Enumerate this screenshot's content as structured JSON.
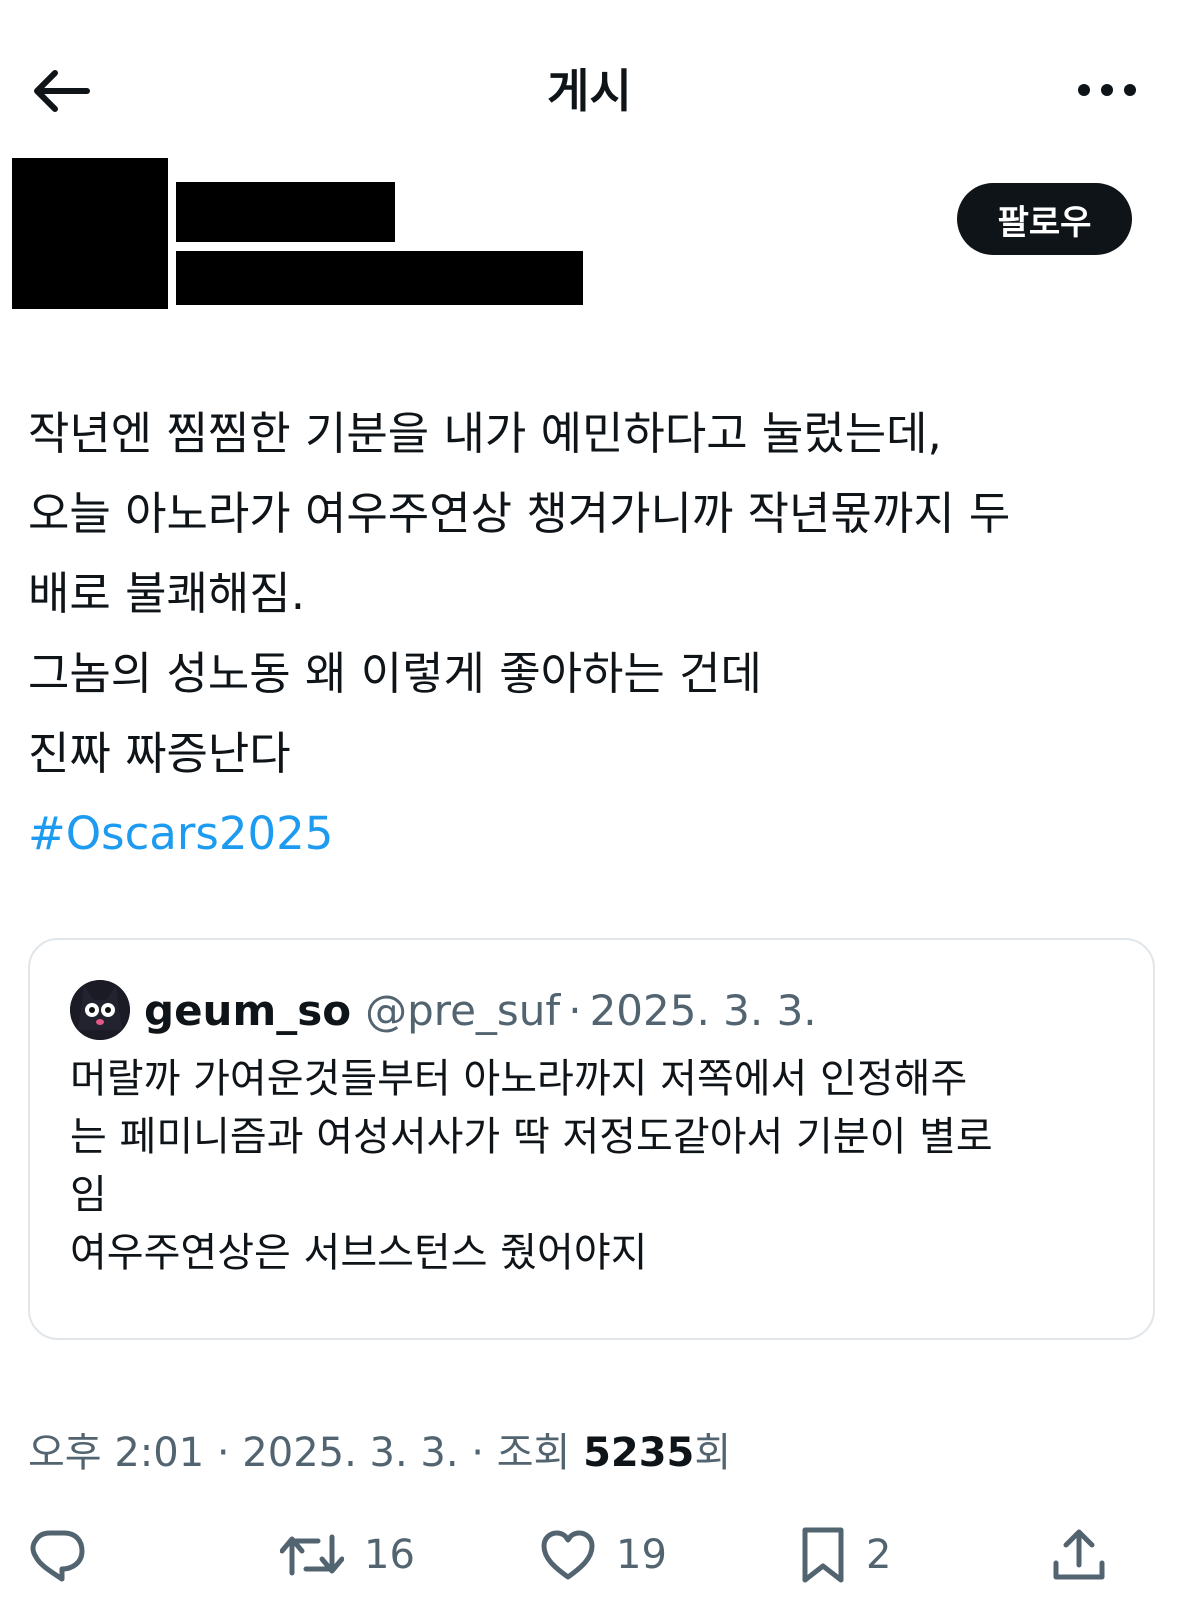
{
  "header": {
    "title": "게시"
  },
  "author": {
    "follow_label": "팔로우"
  },
  "post": {
    "lines": [
      "작년엔 찜찜한 기분을 내가 예민하다고 눌렀는데,",
      "오늘 아노라가 여우주연상 챙겨가니까 작년몫까지 두",
      "배로 불쾌해짐.",
      "그놈의 성노동 왜 이렇게 좋아하는 건데",
      "진짜 짜증난다"
    ],
    "hashtag": "#Oscars2025"
  },
  "quote": {
    "name": "geum_so",
    "handle": "@pre_suf",
    "sep": "·",
    "date": "2025. 3. 3.",
    "lines": [
      "머랄까 가여운것들부터 아노라까지 저쪽에서 인정해주",
      "는 페미니즘과 여성서사가 딱 저정도같아서 기분이 별로",
      "임",
      "여우주연상은 서브스턴스 줬어야지"
    ]
  },
  "meta": {
    "time": "오후 2:01",
    "sep1": " · ",
    "date": "2025. 3. 3.",
    "sep2": " · ",
    "views_prefix": "조회 ",
    "views_count": "5235",
    "views_suffix": "회"
  },
  "actions": {
    "reply_icon": "reply-icon",
    "retweet_icon": "retweet-icon",
    "retweets": "16",
    "like_icon": "heart-icon",
    "likes": "19",
    "bookmark_icon": "bookmark-icon",
    "bookmarks": "2",
    "share_icon": "share-icon"
  },
  "colors": {
    "text": "#0f1419",
    "secondary": "#536471",
    "link": "#1d9bf0",
    "border": "#e1e6ea"
  }
}
